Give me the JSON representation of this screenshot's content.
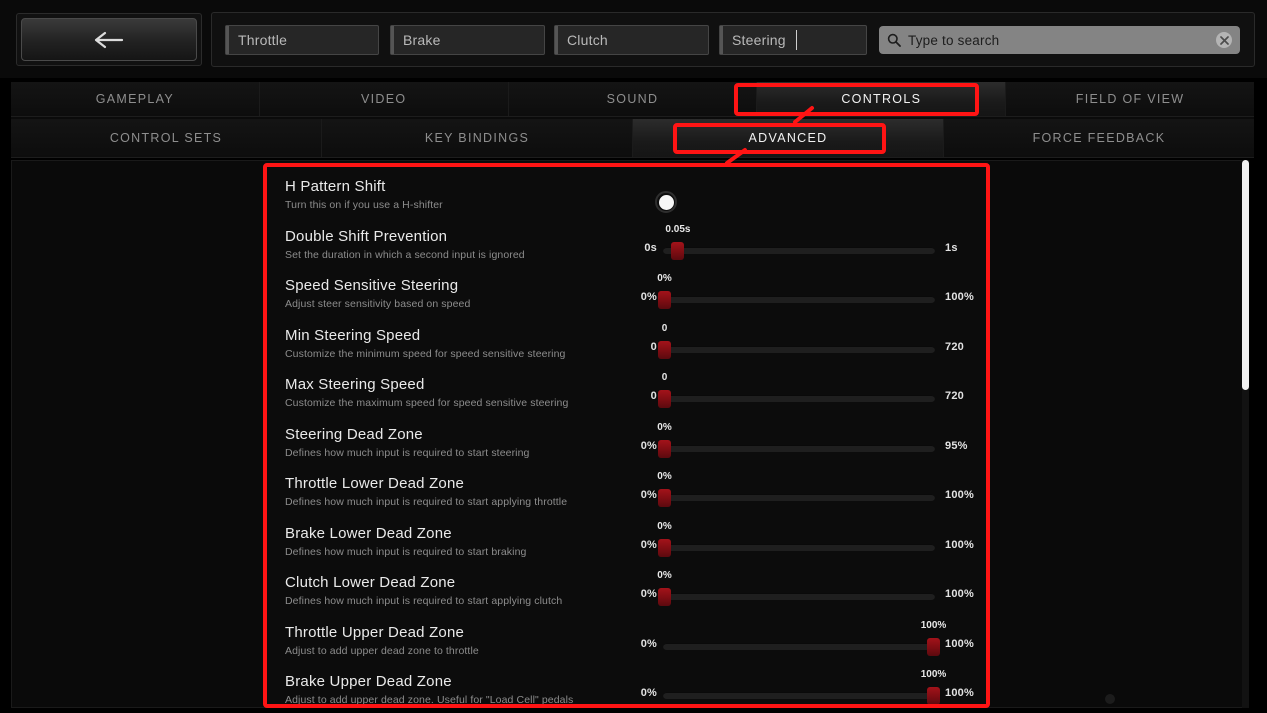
{
  "topbar": {
    "back_button": {
      "icon": "arrow-left-icon",
      "label": ""
    },
    "fields": [
      {
        "name": "Throttle",
        "value": ""
      },
      {
        "name": "Brake",
        "value": ""
      },
      {
        "name": "Clutch",
        "value": ""
      },
      {
        "name": "Steering",
        "value": ""
      }
    ],
    "search": {
      "icon": "search-icon",
      "placeholder": "Type to search",
      "value": "",
      "clear_icon": "close-icon"
    }
  },
  "tabs_primary": [
    {
      "label": "GAMEPLAY",
      "active": false
    },
    {
      "label": "VIDEO",
      "active": false
    },
    {
      "label": "SOUND",
      "active": false
    },
    {
      "label": "CONTROLS",
      "active": true
    },
    {
      "label": "FIELD OF VIEW",
      "active": false
    }
  ],
  "tabs_secondary": [
    {
      "label": "CONTROL SETS",
      "active": false
    },
    {
      "label": "KEY BINDINGS",
      "active": false
    },
    {
      "label": "ADVANCED",
      "active": true
    },
    {
      "label": "FORCE FEEDBACK",
      "active": false
    }
  ],
  "settings": [
    {
      "title": "H Pattern Shift",
      "desc": "Turn this on if you use a H-shifter",
      "control": "toggle",
      "toggle_state": "on"
    },
    {
      "title": "Double Shift Prevention",
      "desc": "Set the duration in which a second input is ignored",
      "control": "slider",
      "min_label": "0s",
      "max_label": "1s",
      "value_label": "0.05s",
      "percent": 5
    },
    {
      "title": "Speed Sensitive Steering",
      "desc": "Adjust steer sensitivity based on speed",
      "control": "slider",
      "min_label": "0%",
      "max_label": "100%",
      "value_label": "0%",
      "percent": 0
    },
    {
      "title": "Min Steering Speed",
      "desc": "Customize the minimum speed for speed sensitive steering",
      "control": "slider",
      "min_label": "0",
      "max_label": "720",
      "value_label": "0",
      "percent": 0
    },
    {
      "title": "Max Steering Speed",
      "desc": "Customize the maximum speed for speed sensitive steering",
      "control": "slider",
      "min_label": "0",
      "max_label": "720",
      "value_label": "0",
      "percent": 0
    },
    {
      "title": "Steering Dead Zone",
      "desc": "Defines how much input is required to start steering",
      "control": "slider",
      "min_label": "0%",
      "max_label": "95%",
      "value_label": "0%",
      "percent": 0
    },
    {
      "title": "Throttle Lower Dead Zone",
      "desc": "Defines how much input is required to start applying throttle",
      "control": "slider",
      "min_label": "0%",
      "max_label": "100%",
      "value_label": "0%",
      "percent": 0
    },
    {
      "title": "Brake Lower Dead Zone",
      "desc": "Defines how much input is required to start braking",
      "control": "slider",
      "min_label": "0%",
      "max_label": "100%",
      "value_label": "0%",
      "percent": 0
    },
    {
      "title": "Clutch Lower Dead Zone",
      "desc": "Defines how much input is required to start applying clutch",
      "control": "slider",
      "min_label": "0%",
      "max_label": "100%",
      "value_label": "0%",
      "percent": 0
    },
    {
      "title": "Throttle Upper Dead Zone",
      "desc": "Adjust to add upper dead zone to throttle",
      "control": "slider",
      "min_label": "0%",
      "max_label": "100%",
      "value_label": "100%",
      "percent": 100
    },
    {
      "title": "Brake Upper Dead Zone",
      "desc": "Adjust to add upper dead zone. Useful for \"Load Cell\" pedals",
      "control": "slider",
      "min_label": "0%",
      "max_label": "100%",
      "value_label": "100%",
      "percent": 100
    }
  ],
  "annotations": {
    "color": "#ff1414",
    "boxes": [
      "CONTROLS",
      "ADVANCED",
      "settings-panel"
    ]
  },
  "colors": {
    "accent_red": "#ff1414",
    "slider_handle": "#8e1015",
    "panel_bg": "#0c0c0c",
    "text_primary": "#eaeaea",
    "text_secondary": "#8d8d8d"
  }
}
